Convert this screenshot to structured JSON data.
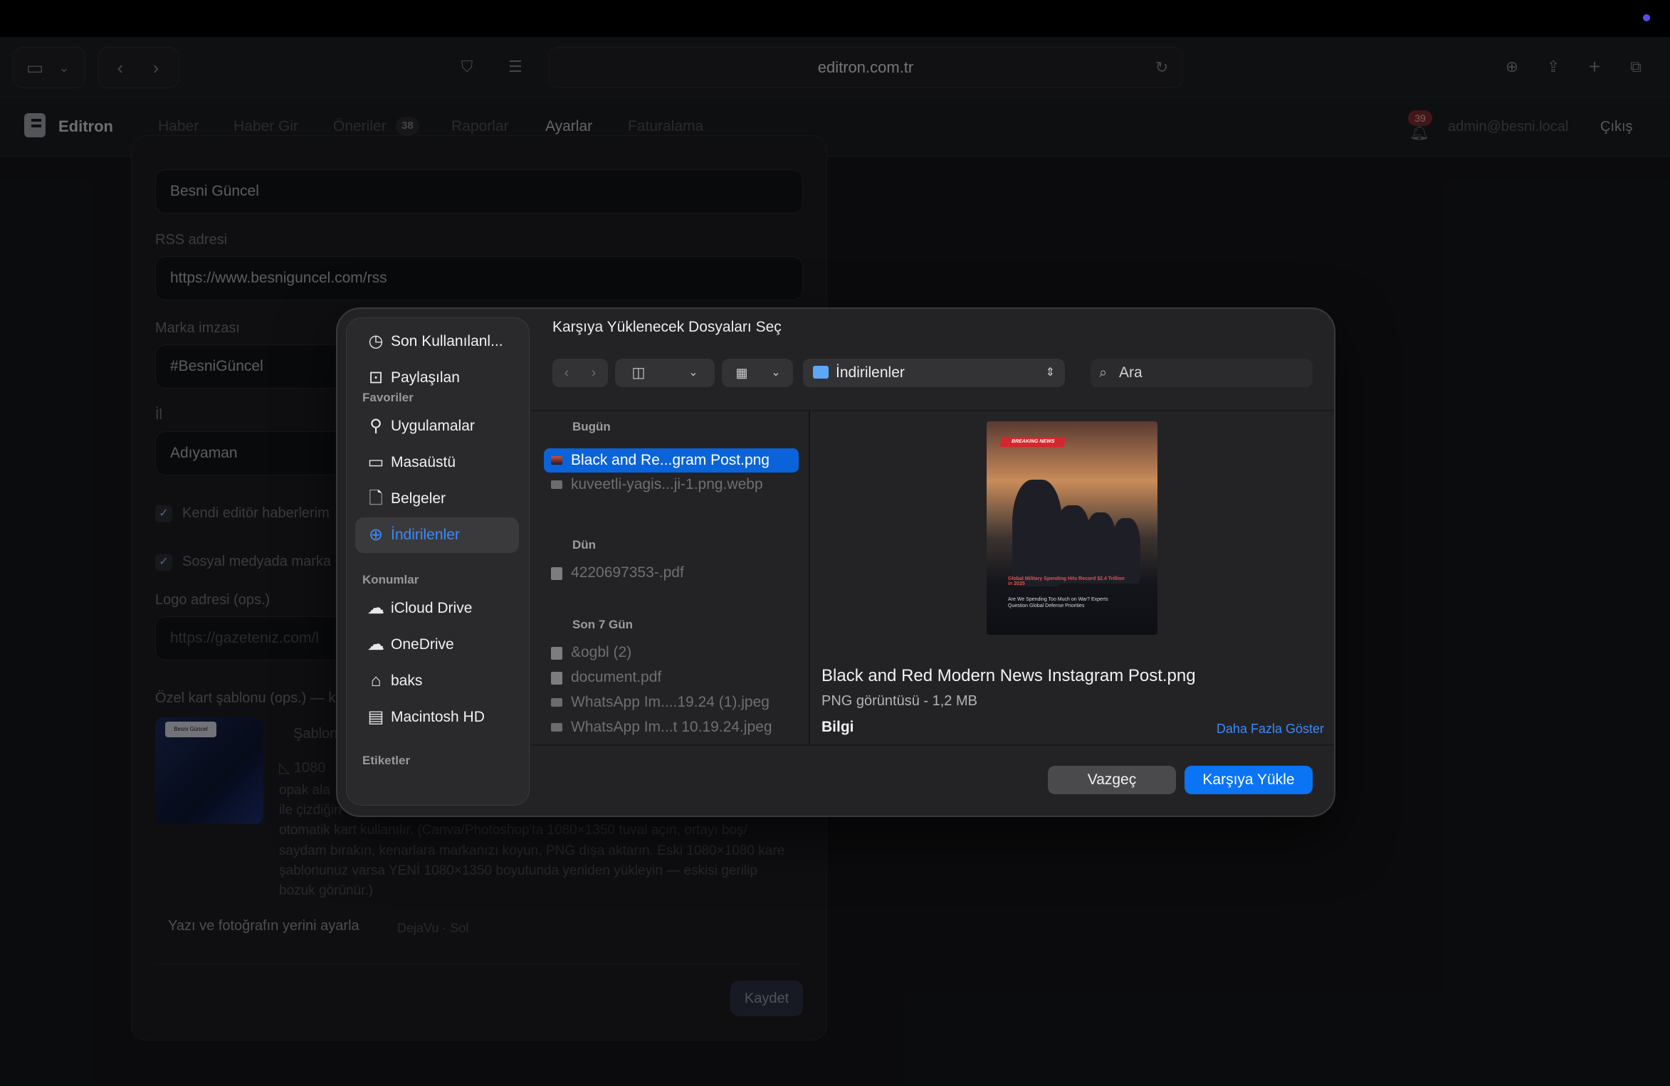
{
  "browser": {
    "url": "editron.com.tr"
  },
  "app": {
    "brand": "Editron",
    "nav": [
      {
        "label": "Haber"
      },
      {
        "label": "Haber Gir"
      },
      {
        "label": "Öneriler",
        "badge": "38"
      },
      {
        "label": "Raporlar"
      },
      {
        "label": "Ayarlar",
        "active": true
      },
      {
        "label": "Faturalama"
      }
    ],
    "notifications": "39",
    "user": "admin@besni.local",
    "logout": "Çıkış"
  },
  "settings": {
    "site_name_value": "Besni Güncel",
    "rss_label": "RSS adresi",
    "rss_value": "https://www.besniguncel.com/rss",
    "brand_sig_label": "Marka imzası",
    "brand_sig_value": "#BesniGüncel",
    "city_label": "İl",
    "city_value": "Adıyaman",
    "check1": "Kendi editör haberlerim",
    "check2": "Sosyal medyada marka",
    "logo_label": "Logo adresi (ops.)",
    "logo_placeholder": "https://gazeteniz.com/l",
    "card_template_label": "Özel kart şablonu (ops.) — k",
    "template_title": "Şablon",
    "template_size": "1080",
    "template_desc_1": "opak ala",
    "template_desc_2": "ile çizdiğin",
    "template_desc_3": "otomatik kart kullanılır. (Canva/Photoshop'ta 1080×1350 tuval açın, ortayı boş/",
    "template_desc_4": "saydam bırakın, kenarlara markanızı koyun, PNG dışa aktarın. Eski 1080×1080 kare",
    "template_desc_5": "şablonunuz varsa YENİ 1080×1350 boyutunda yeniden yükleyin — eskisi gerilip",
    "template_desc_6": "bozuk görünür.)",
    "thumb_label": "Besni Güncel",
    "layout_btn": "Yazı ve fotoğrafın yerini ayarla",
    "layout_meta": "DejaVu · Sol",
    "save": "Kaydet"
  },
  "dialog": {
    "title": "Karşıya Yüklenecek Dosyaları Seç",
    "location": "İndirilenler",
    "search_placeholder": "Ara",
    "sidebar": {
      "top": [
        {
          "label": "Son Kullanılanl...",
          "icon": "clock-icon"
        },
        {
          "label": "Paylaşılan",
          "icon": "shared-folder-icon"
        }
      ],
      "favorites_title": "Favoriler",
      "favorites": [
        {
          "label": "Uygulamalar",
          "icon": "apps-icon"
        },
        {
          "label": "Masaüstü",
          "icon": "desktop-icon"
        },
        {
          "label": "Belgeler",
          "icon": "document-icon"
        },
        {
          "label": "İndirilenler",
          "icon": "download-icon",
          "selected": true
        }
      ],
      "locations_title": "Konumlar",
      "locations": [
        {
          "label": "iCloud Drive",
          "icon": "cloud-icon"
        },
        {
          "label": "OneDrive",
          "icon": "onedrive-icon"
        },
        {
          "label": "baks",
          "icon": "home-icon"
        },
        {
          "label": "Macintosh HD",
          "icon": "disk-icon"
        }
      ],
      "tags_title": "Etiketler"
    },
    "groups": {
      "today": "Bugün",
      "yesterday": "Dün",
      "last7": "Son 7 Gün"
    },
    "files": {
      "today": [
        "Black and Re...gram Post.png",
        "kuveetli-yagis...ji-1.png.webp"
      ],
      "yesterday": [
        "4220697353-.pdf"
      ],
      "last7": [
        "&ogbl (2)",
        "document.pdf",
        "WhatsApp Im....19.24 (1).jpeg",
        "WhatsApp Im...t 10.19.24.jpeg"
      ]
    },
    "preview": {
      "badge": "BREAKING NEWS",
      "headline": "Global Military Spending Hits Record $2.4 Trillion in 2025",
      "sub": "Are We Spending Too Much on War? Experts Question Global Defense Priorities",
      "name": "Black and Red Modern News Instagram Post.png",
      "kind": "PNG görüntüsü - 1,2 MB",
      "info": "Bilgi",
      "more": "Daha Fazla Göster"
    },
    "cancel": "Vazgeç",
    "upload": "Karşıya Yükle"
  }
}
